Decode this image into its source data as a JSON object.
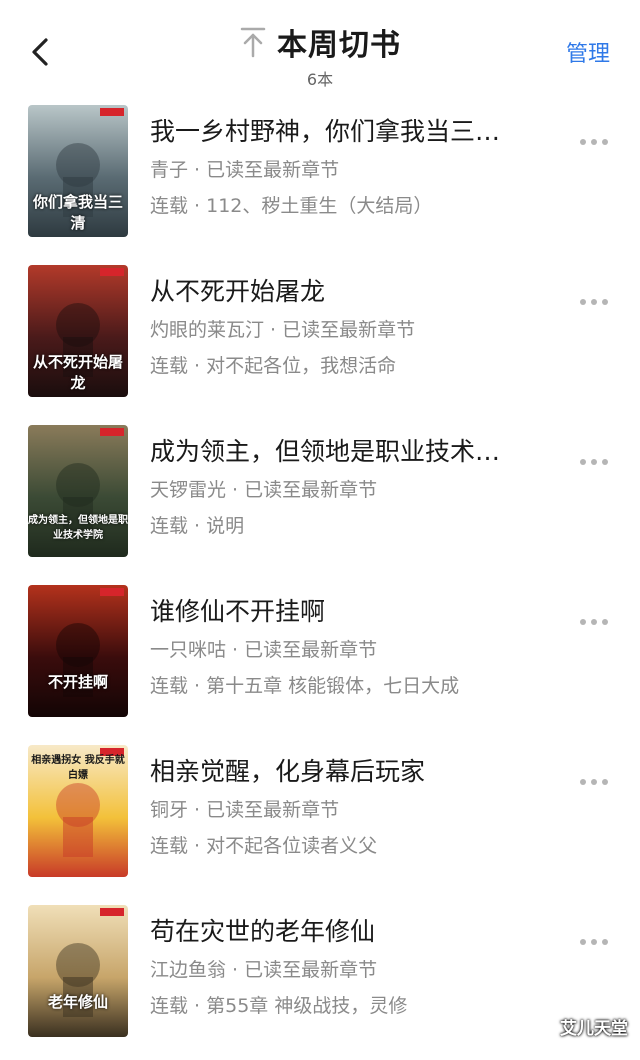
{
  "header": {
    "title": "本周切书",
    "count": "6本",
    "manage_label": "管理"
  },
  "books": [
    {
      "title": "我一乡村野神，你们拿我当三…",
      "meta": "青子 · 已读至最新章节",
      "status": "连载 · 112、秽土重生（大结局）",
      "cover_text": "你们拿我当三清",
      "colors": [
        "#5a6b73",
        "#b9c6c8",
        "#2e3a40"
      ]
    },
    {
      "title": "从不死开始屠龙",
      "meta": "灼眼的莱瓦汀 · 已读至最新章节",
      "status": "连载 · 对不起各位，我想活命",
      "cover_text": "从不死开始屠龙",
      "colors": [
        "#4a1a1a",
        "#b33a2a",
        "#1a0d0d"
      ]
    },
    {
      "title": "成为领主，但领地是职业技术…",
      "meta": "天锣雷光 · 已读至最新章节",
      "status": "连载 · 说明",
      "cover_text": "成为领主，但领地是职业技术学院",
      "colors": [
        "#3b4a35",
        "#8a7b5a",
        "#1f2a1d"
      ]
    },
    {
      "title": "谁修仙不开挂啊",
      "meta": "一只咪咕 · 已读至最新章节",
      "status": "连载 · 第十五章 核能锻体，七日大成",
      "cover_text": "不开挂啊",
      "colors": [
        "#3a0c0c",
        "#b4321c",
        "#130505"
      ]
    },
    {
      "title": "相亲觉醒，化身幕后玩家",
      "meta": "铜牙 · 已读至最新章节",
      "status": "连载 · 对不起各位读者义父",
      "cover_text": "相亲遇拐女 我反手就白嫖",
      "colors": [
        "#f3c13a",
        "#f7e9c8",
        "#c83a28"
      ]
    },
    {
      "title": "苟在灾世的老年修仙",
      "meta": "江边鱼翁 · 已读至最新章节",
      "status": "连载 · 第55章 神级战技，灵修",
      "cover_text": "老年修仙",
      "colors": [
        "#c7a56a",
        "#f0dfb8",
        "#3a3020"
      ]
    }
  ],
  "icons": {
    "back": "chevron-left-icon",
    "title": "arrow-up-to-top-icon",
    "more": "more-horizontal-icon"
  },
  "watermark": "艾儿天堂"
}
